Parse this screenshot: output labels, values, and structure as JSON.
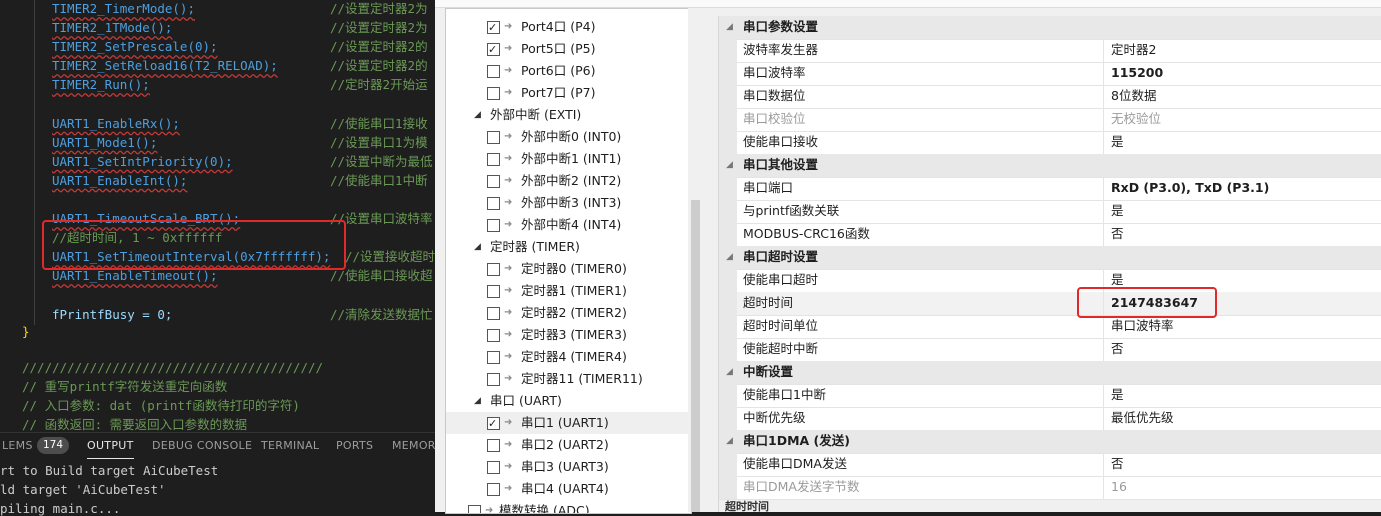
{
  "editor": {
    "lines": [
      {
        "code": "TIMER2_TimerMode();",
        "comment": "//设置定时器2为"
      },
      {
        "code": "TIMER2_1TMode();",
        "comment": "//设置定时器2为"
      },
      {
        "code": "TIMER2_SetPrescale(0);",
        "comment": "//设置定时器2的"
      },
      {
        "code": "TIMER2_SetReload16(T2_RELOAD);",
        "comment": "//设置定时器2的"
      },
      {
        "code": "TIMER2_Run();",
        "comment": "//定时器2开始运"
      },
      {
        "code": "",
        "comment": ""
      },
      {
        "code": "UART1_EnableRx();",
        "comment": "//使能串口1接收"
      },
      {
        "code": "UART1_Mode1();",
        "comment": "//设置串口1为模"
      },
      {
        "code": "UART1_SetIntPriority(0);",
        "comment": "//设置中断为最低"
      },
      {
        "code": "UART1_EnableInt();",
        "comment": "//使能串口1中断"
      },
      {
        "code": "",
        "comment": ""
      },
      {
        "code": "UART1_TimeoutScale_BRT();",
        "comment": "//设置串口波特率"
      },
      {
        "code": "",
        "comment": "//超时时间, 1 ~ 0xffffff"
      },
      {
        "code": "UART1_SetTimeoutInterval(0x7fffffff);",
        "comment": "//设置接收超时"
      },
      {
        "code": "UART1_EnableTimeout();",
        "comment": "//使能串口接收超"
      },
      {
        "code": "",
        "comment": ""
      },
      {
        "code": "fPrintfBusy = 0;",
        "comment": "//清除发送数据忙"
      }
    ],
    "close_brace": "}",
    "comment_block": [
      "////////////////////////////////////////",
      "// 重写printf字符发送重定向函数",
      "// 入口参数: dat (printf函数待打印的字符)",
      "// 函数返回: 需要返回入口参数的数据"
    ]
  },
  "panel": {
    "tabs": [
      "LEMS",
      "OUTPUT",
      "DEBUG CONSOLE",
      "TERMINAL",
      "PORTS",
      "MEMOR"
    ],
    "problems_count": "174",
    "active_tab": "OUTPUT",
    "output": [
      "rt to Build target AiCubeTest",
      "ld target 'AiCubeTest'",
      "piling main.c..."
    ]
  },
  "tree": {
    "items": [
      {
        "level": 2,
        "label": "Port4口 (P4)",
        "checked": true
      },
      {
        "level": 2,
        "label": "Port5口 (P5)",
        "checked": true
      },
      {
        "level": 2,
        "label": "Port6口 (P6)",
        "checked": false
      },
      {
        "level": 2,
        "label": "Port7口 (P7)",
        "checked": false
      },
      {
        "level": 1,
        "label": "外部中断 (EXTI)"
      },
      {
        "level": 2,
        "label": "外部中断0 (INT0)",
        "checked": false
      },
      {
        "level": 2,
        "label": "外部中断1 (INT1)",
        "checked": false
      },
      {
        "level": 2,
        "label": "外部中断2 (INT2)",
        "checked": false
      },
      {
        "level": 2,
        "label": "外部中断3 (INT3)",
        "checked": false
      },
      {
        "level": 2,
        "label": "外部中断4 (INT4)",
        "checked": false
      },
      {
        "level": 1,
        "label": "定时器 (TIMER)"
      },
      {
        "level": 2,
        "label": "定时器0 (TIMER0)",
        "checked": false
      },
      {
        "level": 2,
        "label": "定时器1 (TIMER1)",
        "checked": false
      },
      {
        "level": 2,
        "label": "定时器2 (TIMER2)",
        "checked": false
      },
      {
        "level": 2,
        "label": "定时器3 (TIMER3)",
        "checked": false
      },
      {
        "level": 2,
        "label": "定时器4 (TIMER4)",
        "checked": false
      },
      {
        "level": 2,
        "label": "定时器11 (TIMER11)",
        "checked": false
      },
      {
        "level": 1,
        "label": "串口 (UART)"
      },
      {
        "level": 2,
        "label": "串口1 (UART1)",
        "checked": true,
        "selected": true
      },
      {
        "level": 2,
        "label": "串口2 (UART2)",
        "checked": false
      },
      {
        "level": 2,
        "label": "串口3 (UART3)",
        "checked": false
      },
      {
        "level": 2,
        "label": "串口4 (UART4)",
        "checked": false
      },
      {
        "level": 0,
        "label": "模数转换 (ADC)",
        "checked": false
      }
    ]
  },
  "properties": {
    "rows": [
      {
        "type": "category",
        "key": "串口参数设置"
      },
      {
        "key": "波特率发生器",
        "value": "定时器2"
      },
      {
        "key": "串口波特率",
        "value": "115200",
        "bold": true
      },
      {
        "key": "串口数据位",
        "value": "8位数据"
      },
      {
        "key": "串口校验位",
        "value": "无校验位",
        "disabled": true
      },
      {
        "key": "使能串口接收",
        "value": "是"
      },
      {
        "type": "category",
        "key": "串口其他设置"
      },
      {
        "key": "串口端口",
        "value": "RxD (P3.0), TxD (P3.1)",
        "bold": true
      },
      {
        "key": "与printf函数关联",
        "value": "是"
      },
      {
        "key": "MODBUS-CRC16函数",
        "value": "否"
      },
      {
        "type": "category",
        "key": "串口超时设置"
      },
      {
        "key": "使能串口超时",
        "value": "是"
      },
      {
        "key": "超时时间",
        "value": "2147483647",
        "bold": true,
        "selected": true
      },
      {
        "key": "超时时间单位",
        "value": "串口波特率"
      },
      {
        "key": "使能超时中断",
        "value": "否"
      },
      {
        "type": "category",
        "key": "中断设置"
      },
      {
        "key": "使能串口1中断",
        "value": "是"
      },
      {
        "key": "中断优先级",
        "value": "最低优先级"
      },
      {
        "type": "category",
        "key": "串口1DMA (发送)"
      },
      {
        "key": "使能串口DMA发送",
        "value": "否"
      },
      {
        "key": "串口DMA发送字节数",
        "value": "16",
        "disabled": true
      }
    ],
    "footer": "超时时间"
  },
  "colors": {
    "highlight_box": "#e02a2a"
  }
}
